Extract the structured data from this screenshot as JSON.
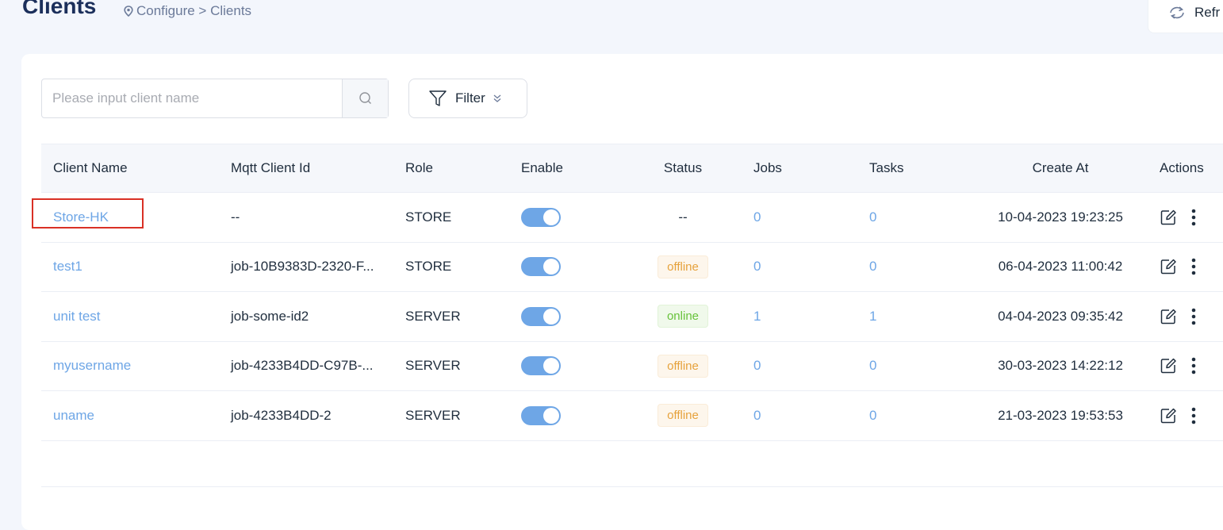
{
  "header": {
    "title": "Clients",
    "breadcrumb": "Configure > Clients",
    "refresh_label": "Refr"
  },
  "toolbar": {
    "search_placeholder": "Please input client name",
    "filter_label": "Filter"
  },
  "table": {
    "columns": [
      "Client Name",
      "Mqtt Client Id",
      "Role",
      "Enable",
      "Status",
      "Jobs",
      "Tasks",
      "Create At",
      "Actions"
    ],
    "rows": [
      {
        "name": "Store-HK",
        "mqtt_id": "--",
        "role": "STORE",
        "enabled": true,
        "status": "--",
        "jobs": "0",
        "tasks": "0",
        "created": "10-04-2023 19:23:25"
      },
      {
        "name": "test1",
        "mqtt_id": "job-10B9383D-2320-F...",
        "role": "STORE",
        "enabled": true,
        "status": "offline",
        "jobs": "0",
        "tasks": "0",
        "created": "06-04-2023 11:00:42"
      },
      {
        "name": "unit test",
        "mqtt_id": "job-some-id2",
        "role": "SERVER",
        "enabled": true,
        "status": "online",
        "jobs": "1",
        "tasks": "1",
        "created": "04-04-2023 09:35:42"
      },
      {
        "name": "myusername",
        "mqtt_id": "job-4233B4DD-C97B-...",
        "role": "SERVER",
        "enabled": true,
        "status": "offline",
        "jobs": "0",
        "tasks": "0",
        "created": "30-03-2023 14:22:12"
      },
      {
        "name": "uname",
        "mqtt_id": "job-4233B4DD-2",
        "role": "SERVER",
        "enabled": true,
        "status": "offline",
        "jobs": "0",
        "tasks": "0",
        "created": "21-03-2023 19:53:53"
      }
    ]
  },
  "colors": {
    "accent": "#6ea6e6",
    "title": "#1b2f5b",
    "offline": "#e6a23c",
    "online": "#67c23a",
    "highlight": "#d93025"
  }
}
